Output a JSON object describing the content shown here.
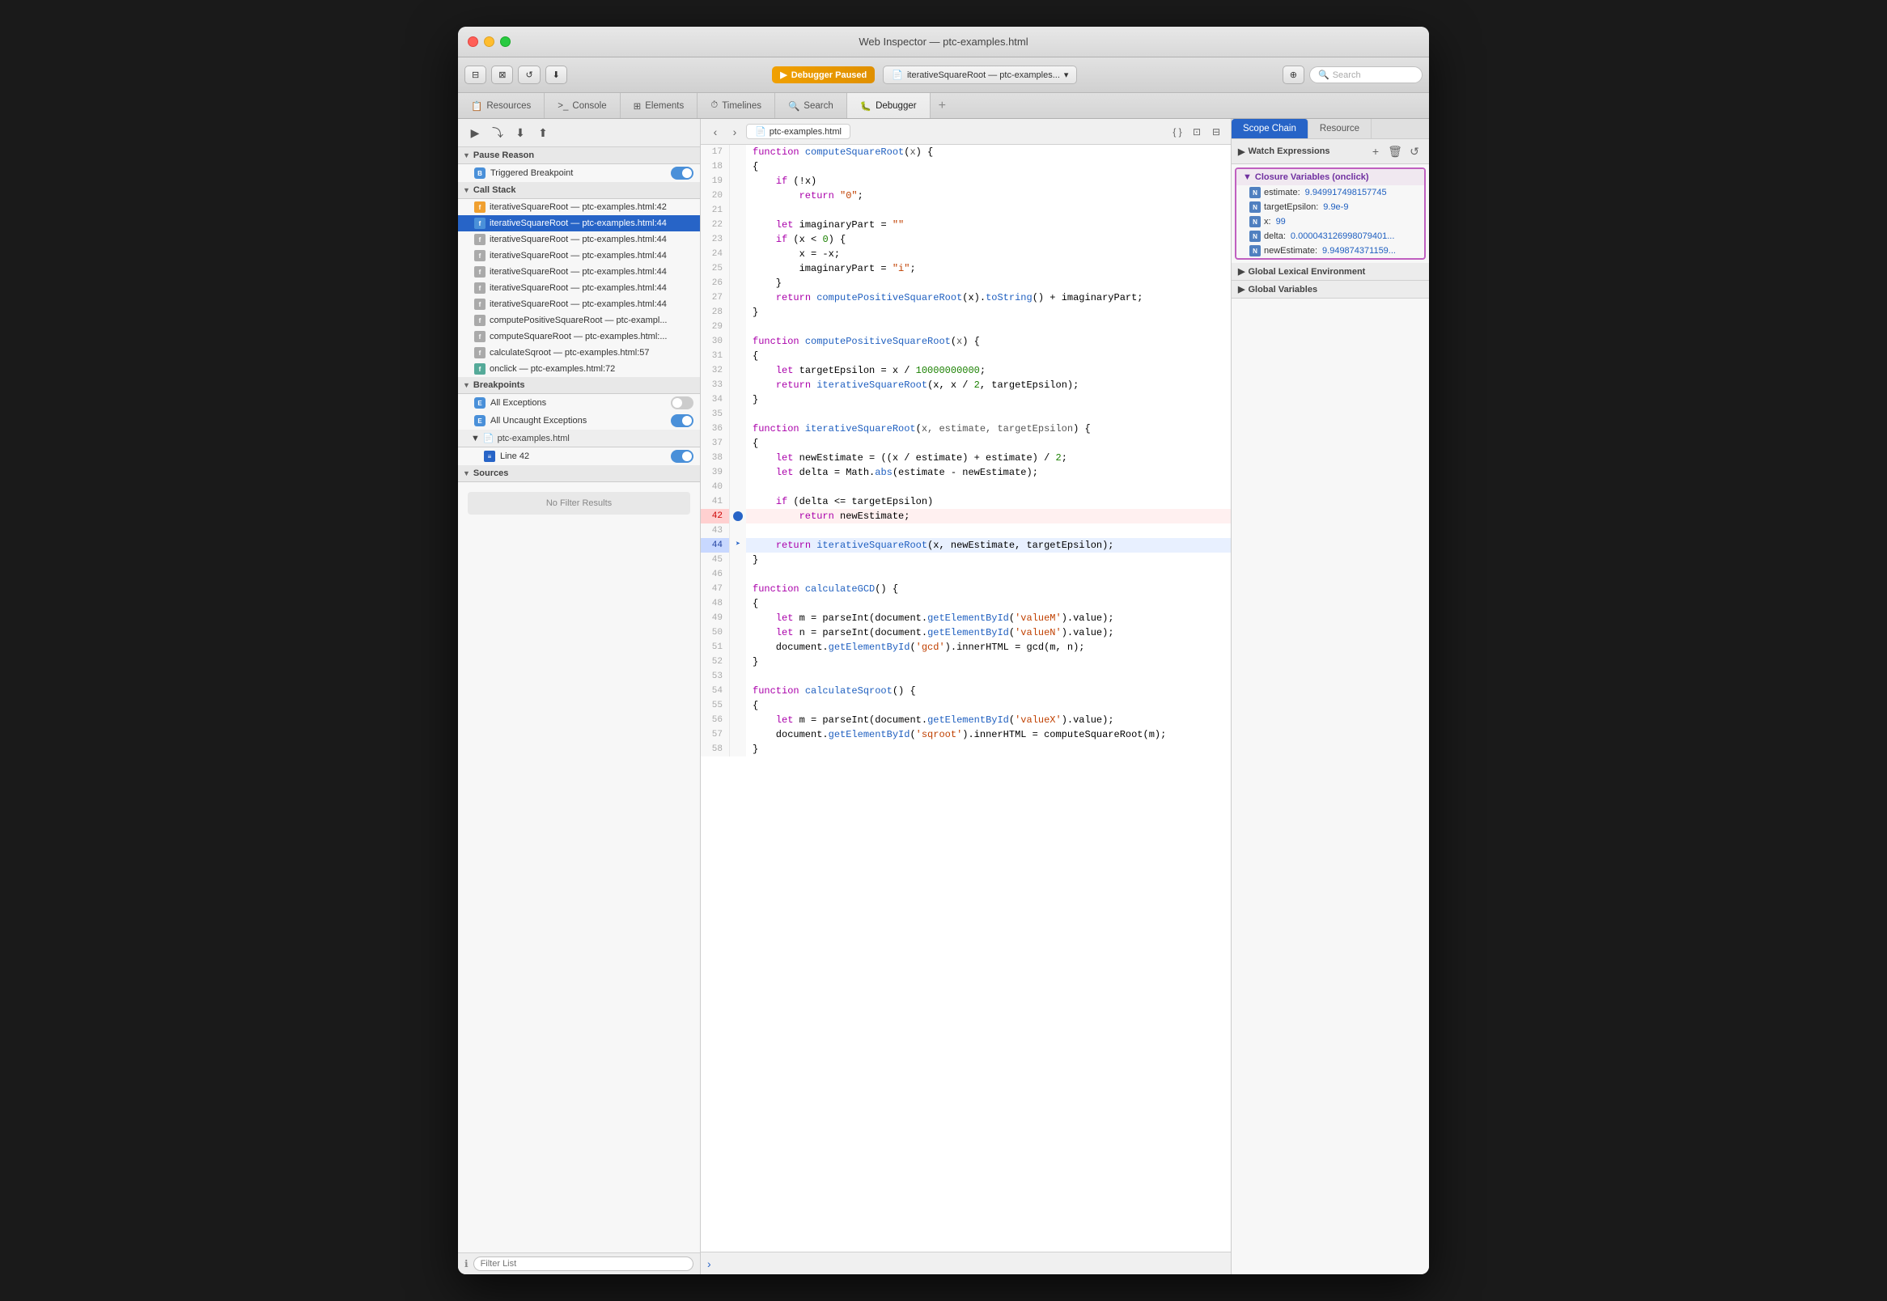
{
  "window": {
    "title": "Web Inspector — ptc-examples.html"
  },
  "toolbar": {
    "debugger_status": "Debugger Paused",
    "file_tab": "iterativeSquareRoot — ptc-examples...",
    "search_placeholder": "Search"
  },
  "tabs": [
    {
      "label": "Resources",
      "active": false
    },
    {
      "label": "Console",
      "active": false
    },
    {
      "label": "Elements",
      "active": false
    },
    {
      "label": "Timelines",
      "active": false
    },
    {
      "label": "Search",
      "active": false
    },
    {
      "label": "Debugger",
      "active": true
    }
  ],
  "left_panel": {
    "pause_reason": {
      "label": "Pause Reason",
      "value": "Triggered Breakpoint"
    },
    "call_stack": {
      "label": "Call Stack",
      "items": [
        {
          "name": "iterativeSquareRoot",
          "file": "ptc-examples.html:42",
          "active": false
        },
        {
          "name": "iterativeSquareRoot",
          "file": "ptc-examples.html:44",
          "active": true
        },
        {
          "name": "iterativeSquareRoot",
          "file": "ptc-examples.html:44",
          "active": false
        },
        {
          "name": "iterativeSquareRoot",
          "file": "ptc-examples.html:44",
          "active": false
        },
        {
          "name": "iterativeSquareRoot",
          "file": "ptc-examples.html:44",
          "active": false
        },
        {
          "name": "iterativeSquareRoot",
          "file": "ptc-examples.html:44",
          "active": false
        },
        {
          "name": "iterativeSquareRoot",
          "file": "ptc-examples.html:44",
          "active": false
        },
        {
          "name": "computePositiveSquareRoot",
          "file": "ptc-exampl...",
          "active": false
        },
        {
          "name": "computeSquareRoot",
          "file": "ptc-examples.html:...",
          "active": false
        },
        {
          "name": "calculateSqroot",
          "file": "ptc-examples.html:57",
          "active": false
        },
        {
          "name": "onclick",
          "file": "ptc-examples.html:72",
          "active": false
        }
      ]
    },
    "breakpoints": {
      "label": "Breakpoints",
      "items": [
        {
          "label": "All Exceptions",
          "enabled": false
        },
        {
          "label": "All Uncaught Exceptions",
          "enabled": true
        }
      ],
      "files": [
        {
          "name": "ptc-examples.html",
          "lines": [
            {
              "line": "Line 42",
              "enabled": true
            }
          ]
        }
      ]
    },
    "sources": {
      "label": "Sources",
      "no_filter": "No Filter Results"
    },
    "filter_placeholder": "Filter List"
  },
  "editor": {
    "filename": "ptc-examples.html",
    "lines": [
      {
        "num": 17,
        "content": "function computeSquareRoot(x) {",
        "type": "normal"
      },
      {
        "num": 18,
        "content": "{",
        "type": "normal"
      },
      {
        "num": 19,
        "content": "    if (!x)",
        "type": "normal"
      },
      {
        "num": 20,
        "content": "        return \"0\";",
        "type": "normal"
      },
      {
        "num": 21,
        "content": "",
        "type": "normal"
      },
      {
        "num": 22,
        "content": "    let imaginaryPart = \"\"",
        "type": "normal"
      },
      {
        "num": 23,
        "content": "    if (x < 0) {",
        "type": "normal"
      },
      {
        "num": 24,
        "content": "        x = -x;",
        "type": "normal"
      },
      {
        "num": 25,
        "content": "        imaginaryPart = \"i\";",
        "type": "normal"
      },
      {
        "num": 26,
        "content": "    }",
        "type": "normal"
      },
      {
        "num": 27,
        "content": "    return computePositiveSquareRoot(x).toString() + imaginaryPart;",
        "type": "normal"
      },
      {
        "num": 28,
        "content": "}",
        "type": "normal"
      },
      {
        "num": 29,
        "content": "",
        "type": "normal"
      },
      {
        "num": 30,
        "content": "function computePositiveSquareRoot(x) {",
        "type": "normal"
      },
      {
        "num": 31,
        "content": "{",
        "type": "normal"
      },
      {
        "num": 32,
        "content": "    let targetEpsilon = x / 10000000000;",
        "type": "normal"
      },
      {
        "num": 33,
        "content": "    return iterativeSquareRoot(x, x / 2, targetEpsilon);",
        "type": "normal"
      },
      {
        "num": 34,
        "content": "}",
        "type": "normal"
      },
      {
        "num": 35,
        "content": "",
        "type": "normal"
      },
      {
        "num": 36,
        "content": "function iterativeSquareRoot(x, estimate, targetEpsilon) {",
        "type": "normal"
      },
      {
        "num": 37,
        "content": "{",
        "type": "normal"
      },
      {
        "num": 38,
        "content": "    let newEstimate = ((x / estimate) + estimate) / 2;",
        "type": "normal"
      },
      {
        "num": 39,
        "content": "    let delta = Math.abs(estimate - newEstimate);",
        "type": "normal"
      },
      {
        "num": 40,
        "content": "",
        "type": "normal"
      },
      {
        "num": 41,
        "content": "    if (delta <= targetEpsilon)",
        "type": "normal"
      },
      {
        "num": 42,
        "content": "        return newEstimate;",
        "type": "breakpoint"
      },
      {
        "num": 43,
        "content": "",
        "type": "normal"
      },
      {
        "num": 44,
        "content": "    return iterativeSquareRoot(x, newEstimate, targetEpsilon);",
        "type": "active"
      },
      {
        "num": 45,
        "content": "}",
        "type": "normal"
      },
      {
        "num": 46,
        "content": "",
        "type": "normal"
      },
      {
        "num": 47,
        "content": "function calculateGCD() {",
        "type": "normal"
      },
      {
        "num": 48,
        "content": "{",
        "type": "normal"
      },
      {
        "num": 49,
        "content": "    let m = parseInt(document.getElementById('valueM').value);",
        "type": "normal"
      },
      {
        "num": 50,
        "content": "    let n = parseInt(document.getElementById('valueN').value);",
        "type": "normal"
      },
      {
        "num": 51,
        "content": "    document.getElementById('gcd').innerHTML = gcd(m, n);",
        "type": "normal"
      },
      {
        "num": 52,
        "content": "}",
        "type": "normal"
      },
      {
        "num": 53,
        "content": "",
        "type": "normal"
      },
      {
        "num": 54,
        "content": "function calculateSqroot() {",
        "type": "normal"
      },
      {
        "num": 55,
        "content": "{",
        "type": "normal"
      },
      {
        "num": 56,
        "content": "    let m = parseInt(document.getElementById('valueX').value);",
        "type": "normal"
      },
      {
        "num": 57,
        "content": "    document.getElementById('sqroot').innerHTML = computeSquareRoot(m);",
        "type": "normal"
      },
      {
        "num": 58,
        "content": "}",
        "type": "normal"
      }
    ]
  },
  "right_panel": {
    "tabs": [
      {
        "label": "Scope Chain",
        "active": true
      },
      {
        "label": "Resource",
        "active": false
      }
    ],
    "watch_expressions": {
      "label": "Watch Expressions"
    },
    "closure_variables": {
      "label": "Closure Variables (onclick)",
      "items": [
        {
          "key": "estimate:",
          "value": "9.949917498157745"
        },
        {
          "key": "targetEpsilon:",
          "value": "9.9e-9"
        },
        {
          "key": "x:",
          "value": "99"
        },
        {
          "key": "delta:",
          "value": "0.000043126998079401..."
        },
        {
          "key": "newEstimate:",
          "value": "9.949874371159..."
        }
      ]
    },
    "global_lexical": {
      "label": "Global Lexical Environment"
    },
    "global_variables": {
      "label": "Global Variables"
    }
  }
}
